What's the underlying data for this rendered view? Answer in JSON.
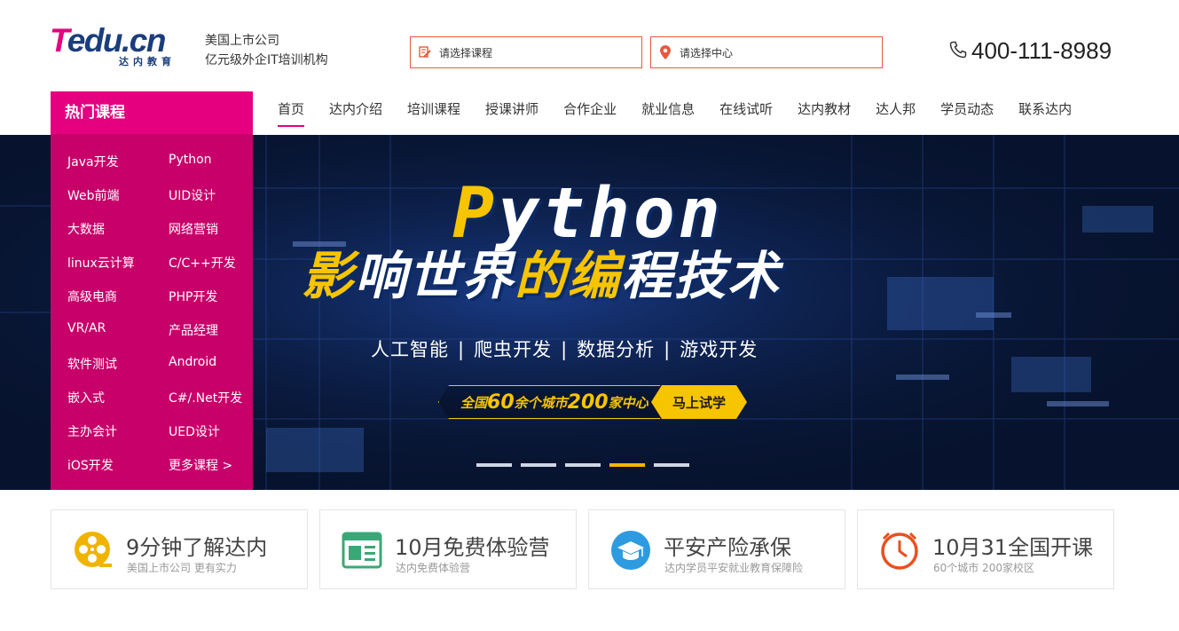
{
  "header": {
    "logo_t": "T",
    "logo_edu": "edu.cn",
    "logo_sub": "达内教育",
    "slogan_line1": "美国上市公司",
    "slogan_line2": "亿元级外企IT培训机构",
    "course_placeholder": "请选择课程",
    "center_placeholder": "请选择中心",
    "phone": "400-111-8989"
  },
  "nav": {
    "hot_courses": "热门课程",
    "items": [
      "首页",
      "达内介绍",
      "培训课程",
      "授课讲师",
      "合作企业",
      "就业信息",
      "在线试听",
      "达内教材",
      "达人邦",
      "学员动态",
      "联系达内"
    ],
    "active_index": 0
  },
  "sidebar": {
    "courses": [
      "Java开发",
      "Python",
      "Web前端",
      "UID设计",
      "大数据",
      "网络营销",
      "linux云计算",
      "C/C++开发",
      "高级电商",
      "PHP开发",
      "VR/AR",
      "产品经理",
      "软件测试",
      "Android",
      "嵌入式",
      "C#/.Net开发",
      "主办会计",
      "UED设计",
      "iOS开发",
      "更多课程 >"
    ]
  },
  "banner": {
    "title_first": "P",
    "title_rest": "ython",
    "subtitle_y1": "影",
    "subtitle_w1": "响世界",
    "subtitle_y2": "的编",
    "subtitle_w2": "程技术",
    "tag1": "人工智能",
    "tag2": "爬虫开发",
    "tag3": "数据分析",
    "tag4": "游戏开发",
    "separator": "|",
    "cta_pre": "全国",
    "cta_num1": "60",
    "cta_mid": "余个城市",
    "cta_num2": "200",
    "cta_post": "家中心",
    "cta_button": "马上试学",
    "slide_count": 5,
    "active_slide": 3
  },
  "features": [
    {
      "title": "9分钟了解达内",
      "subtitle": "美国上市公司 更有实力",
      "icon": "film-reel-icon",
      "color": "#f0b400"
    },
    {
      "title": "10月免费体验营",
      "subtitle": "达内免费体验营",
      "icon": "news-card-icon",
      "color": "#3aa876"
    },
    {
      "title": "平安产险承保",
      "subtitle": "达内学员平安就业教育保障险",
      "icon": "graduation-cap-icon",
      "color": "#2e9be0"
    },
    {
      "title": "10月31全国开课",
      "subtitle": "60个城市 200家校区",
      "icon": "clock-icon",
      "color": "#e8501e"
    }
  ],
  "colors": {
    "brand_magenta": "#e4007f",
    "sidebar": "#c8006a",
    "banner_bg": "#07132e",
    "accent_yellow": "#f7c400",
    "search_border": "#e45a3e"
  }
}
